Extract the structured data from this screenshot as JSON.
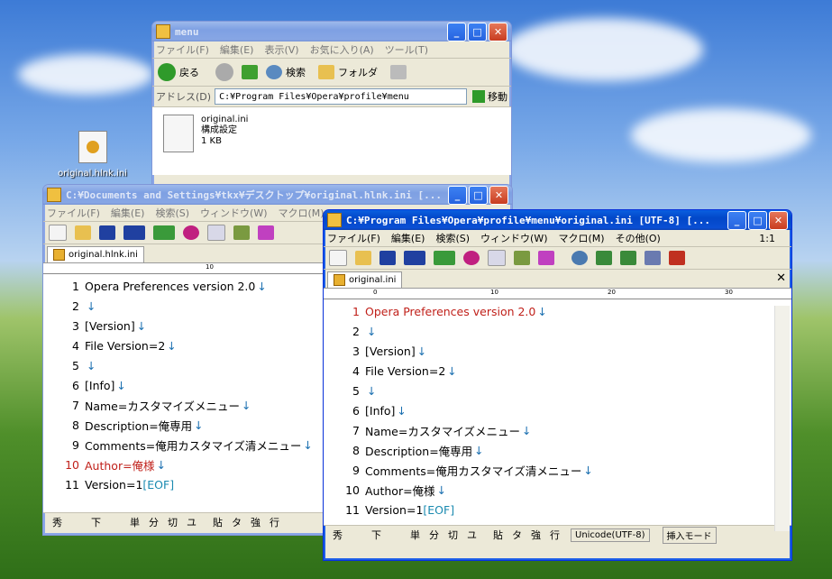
{
  "desktop": {
    "icon_label": "original.hlnk.ini"
  },
  "explorer": {
    "title": "menu",
    "menu": [
      "ファイル(F)",
      "編集(E)",
      "表示(V)",
      "お気に入り(A)",
      "ツール(T)"
    ],
    "toolbar": {
      "back": "戻る",
      "search": "検索",
      "folders": "フォルダ"
    },
    "address_label": "アドレス(D)",
    "address_value": "C:¥Program Files¥Opera¥profile¥menu",
    "go": "移動",
    "file": {
      "name": "original.ini",
      "type": "構成設定",
      "size": "1 KB"
    }
  },
  "editor_back": {
    "title": "C:¥Documents and Settings¥tkx¥デスクトップ¥original.hlnk.ini  [...",
    "menu": [
      "ファイル(F)",
      "編集(E)",
      "検索(S)",
      "ウィンドウ(W)",
      "マクロ(M)"
    ],
    "tab": "original.hlnk.ini",
    "ruler": [
      " ",
      "10"
    ],
    "lines": [
      {
        "n": "1",
        "t": "Opera Preferences version 2.0",
        "nl": "↓"
      },
      {
        "n": "2",
        "t": "",
        "nl": "↓"
      },
      {
        "n": "3",
        "t": "[Version]",
        "nl": "↓"
      },
      {
        "n": "4",
        "t": "File Version=2",
        "nl": "↓"
      },
      {
        "n": "5",
        "t": "",
        "nl": "↓"
      },
      {
        "n": "6",
        "t": "[Info]",
        "nl": "↓"
      },
      {
        "n": "7",
        "t": "Name=カスタマイズメニュー",
        "nl": "↓"
      },
      {
        "n": "8",
        "t": "Description=俺専用",
        "nl": "↓"
      },
      {
        "n": "9",
        "t": "Comments=俺用カスタマイズ清メニュー",
        "nl": "↓"
      },
      {
        "n": "10",
        "t": "Author=俺様",
        "nl": "↓"
      },
      {
        "n": "11",
        "t": "Version=1",
        "nl": "[EOF]"
      }
    ],
    "status": [
      "秀",
      "下",
      "単",
      "分",
      "切",
      "ユ",
      "貼",
      "タ",
      "強",
      "行"
    ]
  },
  "editor_front": {
    "title": "C:¥Program Files¥Opera¥profile¥menu¥original.ini  [UTF-8] [...",
    "menu": [
      "ファイル(F)",
      "編集(E)",
      "検索(S)",
      "ウィンドウ(W)",
      "マクロ(M)",
      "その他(O)"
    ],
    "position": "1:1",
    "tab": "original.ini",
    "ruler": [
      "0",
      "10",
      "20",
      "30"
    ],
    "lines": [
      {
        "n": "1",
        "t": "Opera Preferences version 2.0",
        "nl": "↓"
      },
      {
        "n": "2",
        "t": "",
        "nl": "↓"
      },
      {
        "n": "3",
        "t": "[Version]",
        "nl": "↓"
      },
      {
        "n": "4",
        "t": "File Version=2",
        "nl": "↓"
      },
      {
        "n": "5",
        "t": "",
        "nl": "↓"
      },
      {
        "n": "6",
        "t": "[Info]",
        "nl": "↓"
      },
      {
        "n": "7",
        "t": "Name=カスタマイズメニュー",
        "nl": "↓"
      },
      {
        "n": "8",
        "t": "Description=俺専用",
        "nl": "↓"
      },
      {
        "n": "9",
        "t": "Comments=俺用カスタマイズ清メニュー",
        "nl": "↓"
      },
      {
        "n": "10",
        "t": "Author=俺様",
        "nl": "↓"
      },
      {
        "n": "11",
        "t": "Version=1",
        "nl": "[EOF]"
      }
    ],
    "status": [
      "秀",
      "下",
      "単",
      "分",
      "切",
      "ユ",
      "貼",
      "タ",
      "強",
      "行"
    ],
    "encoding": "Unicode(UTF-8)",
    "mode": "挿入モード"
  },
  "colors": {
    "active_line": "#c0201a",
    "newline": "#1a6fb0"
  }
}
